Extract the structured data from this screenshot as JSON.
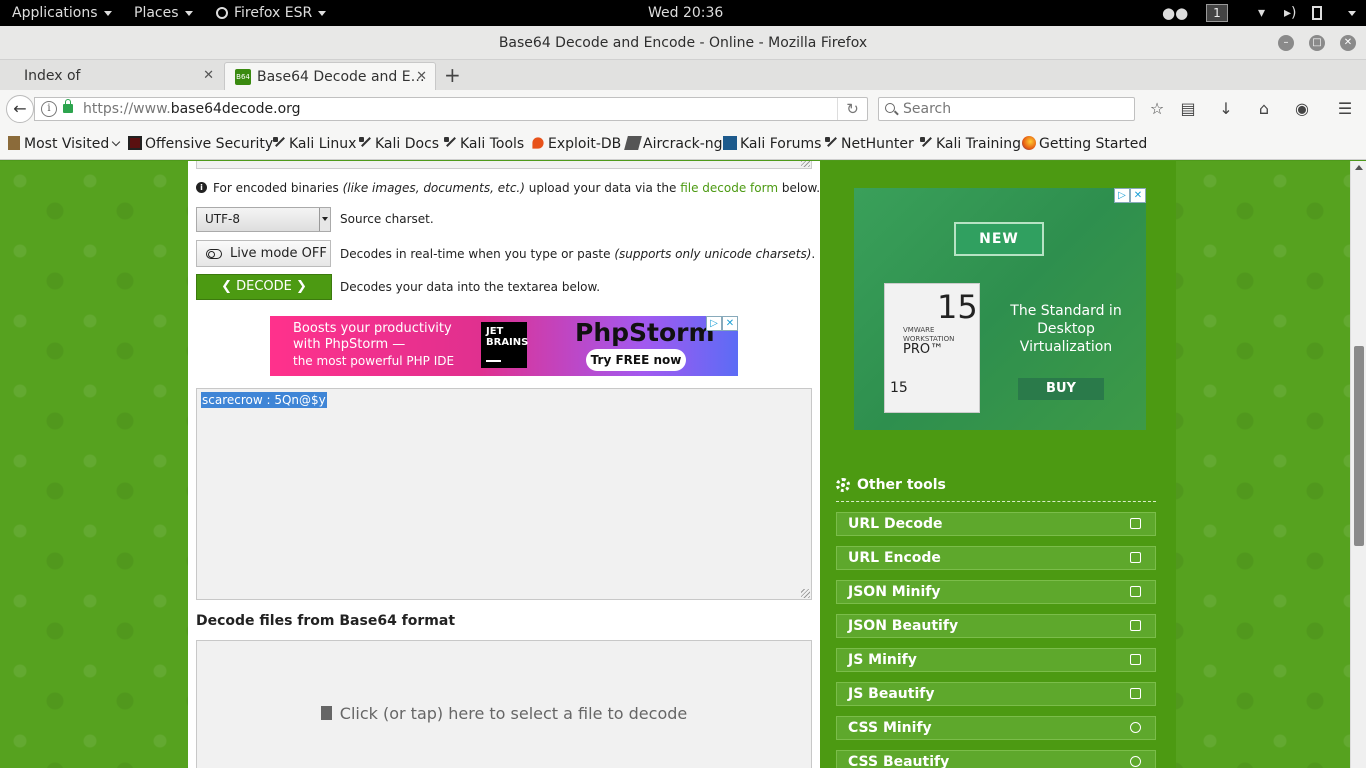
{
  "topbar": {
    "applications": "Applications",
    "places": "Places",
    "browser_menu": "Firefox ESR",
    "clock": "Wed 20:36",
    "workspace": "1"
  },
  "window": {
    "title": "Base64 Decode and Encode - Online - Mozilla Firefox"
  },
  "tabs": [
    {
      "label": "Index of /img/hidden_sec…",
      "active": false
    },
    {
      "label": "Base64 Decode and E…",
      "active": true,
      "favicon": "B64"
    }
  ],
  "navbar": {
    "url_prefix": "https://www.",
    "url_domain": "base64decode.org",
    "search_placeholder": "Search"
  },
  "bookmarks": [
    {
      "label": "Most Visited",
      "icon": "chevron-down-icon"
    },
    {
      "label": "Offensive Security",
      "icon": "offsec-icon"
    },
    {
      "label": "Kali Linux",
      "icon": "kali-dragon-icon"
    },
    {
      "label": "Kali Docs",
      "icon": "kali-dragon-icon"
    },
    {
      "label": "Kali Tools",
      "icon": "kali-dragon-icon"
    },
    {
      "label": "Exploit-DB",
      "icon": "exploit-db-icon"
    },
    {
      "label": "Aircrack-ng",
      "icon": "aircrack-icon"
    },
    {
      "label": "Kali Forums",
      "icon": "kali-forums-icon"
    },
    {
      "label": "NetHunter",
      "icon": "kali-dragon-icon"
    },
    {
      "label": "Kali Training",
      "icon": "kali-dragon-icon"
    },
    {
      "label": "Getting Started",
      "icon": "firefox-icon"
    }
  ],
  "main": {
    "info_prefix": "For encoded binaries ",
    "info_italic": "(like images, documents, etc.)",
    "info_middle": " upload your data via the ",
    "info_link": "file decode form",
    "info_suffix": " below.",
    "charset_value": "UTF-8",
    "charset_desc": "Source charset.",
    "live_mode_label": "Live mode OFF",
    "live_mode_desc_prefix": "Decodes in real-time when you type or paste ",
    "live_mode_desc_italic": "(supports only unicode charsets)",
    "live_mode_desc_suffix": ".",
    "decode_label": "DECODE",
    "decode_desc": "Decodes your data into the textarea below.",
    "output_text": "scarecrow : 5Qn@$y",
    "files_heading": "Decode files from Base64 format",
    "dropzone_label": "Click (or tap) here to select a file to decode"
  },
  "ad_phpstorm": {
    "line1": "Boosts your productivity",
    "line2": "with PhpStorm —",
    "line3": "the most powerful PHP IDE",
    "jb_line1": "JET",
    "jb_line2": "BRAINS",
    "brand": "PhpStorm",
    "cta": "Try FREE now"
  },
  "ad_vmware": {
    "ribbon": "NEW",
    "box_number": "15",
    "box_vendor": "VMWARE",
    "box_product": "WORKSTATION",
    "box_edition": "PRO™",
    "tagline_1": "The Standard in",
    "tagline_2": "Desktop",
    "tagline_3": "Virtualization",
    "buy": "BUY"
  },
  "sidebar": {
    "tools_heading": "Other tools",
    "tools": [
      {
        "label": "URL Decode",
        "icon": "envelope-open-icon"
      },
      {
        "label": "URL Encode",
        "icon": "envelope-icon"
      },
      {
        "label": "JSON Minify",
        "icon": "file-icon"
      },
      {
        "label": "JSON Beautify",
        "icon": "file-icon"
      },
      {
        "label": "JS Minify",
        "icon": "hand-icon"
      },
      {
        "label": "JS Beautify",
        "icon": "hand-icon"
      },
      {
        "label": "CSS Minify",
        "icon": "smile-icon"
      },
      {
        "label": "CSS Beautify",
        "icon": "smile-icon"
      }
    ]
  },
  "colors": {
    "brand_green": "#4c9a12",
    "selection_blue": "#3f85d6"
  }
}
